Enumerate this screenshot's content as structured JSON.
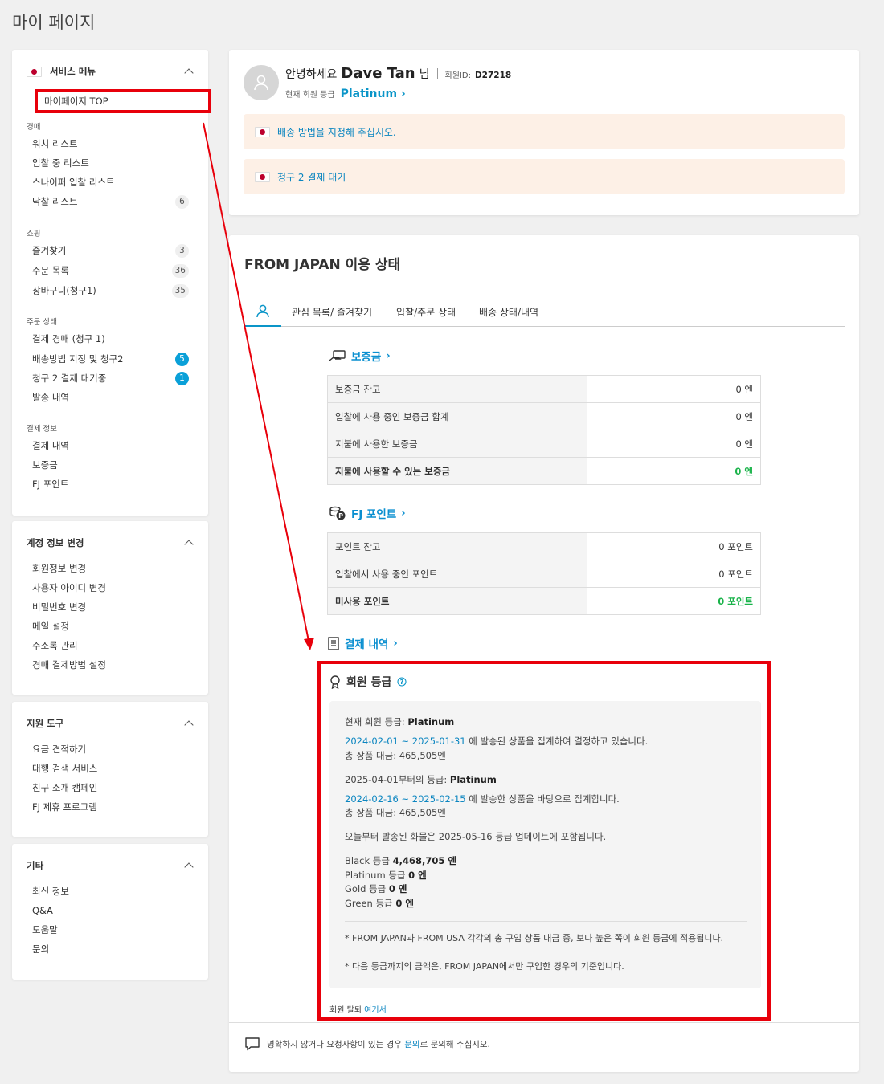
{
  "page_title": "마이 페이지",
  "sidebar": {
    "service_menu": {
      "title": "서비스 메뉴",
      "top_item": "마이페이지 TOP",
      "groups": [
        {
          "label": "경매",
          "items": [
            {
              "label": "워치 리스트",
              "count": ""
            },
            {
              "label": "입찰 중 리스트",
              "count": ""
            },
            {
              "label": "스나이퍼 입찰 리스트",
              "count": ""
            },
            {
              "label": "낙찰 리스트",
              "count": "6"
            }
          ]
        },
        {
          "label": "쇼핑",
          "items": [
            {
              "label": "즐겨찾기",
              "count": "3"
            },
            {
              "label": "주문 목록",
              "count": "36"
            },
            {
              "label": "장바구니(청구1)",
              "count": "35"
            }
          ]
        },
        {
          "label": "주문 상태",
          "items": [
            {
              "label": "결제 경매 (청구 1)",
              "count": ""
            },
            {
              "label": "배송방법 지정 및 청구2",
              "count": "5"
            },
            {
              "label": "청구 2 결제 대기중",
              "count": "1"
            },
            {
              "label": "발송 내역",
              "count": ""
            }
          ]
        },
        {
          "label": "결제 정보",
          "items": [
            {
              "label": "결제 내역"
            },
            {
              "label": "보증금"
            },
            {
              "label": "FJ 포인트"
            }
          ]
        }
      ]
    },
    "account": {
      "title": "계정 정보 변경",
      "items": [
        "회원정보 변경",
        "사용자 아이디 변경",
        "비밀번호 변경",
        "메일 설정",
        "주소록 관리",
        "경매 결제방법 설정"
      ]
    },
    "support": {
      "title": "지원 도구",
      "items": [
        "요금 견적하기",
        "대행 검색 서비스",
        "친구 소개 캠페인",
        "FJ 제휴 프로그램"
      ]
    },
    "etc": {
      "title": "기타",
      "items": [
        "최신 정보",
        "Q&A",
        "도움말",
        "문의"
      ]
    }
  },
  "profile": {
    "hello": "안녕하세요",
    "name": "Dave Tan",
    "honorific": "님",
    "id_label": "회원ID:",
    "id_value": "D27218",
    "grade_label": "현재 회원 등급",
    "grade_value": "Platinum",
    "notices": [
      "배송 방법을 지정해 주십시오.",
      "청구 2 결제 대기"
    ]
  },
  "status": {
    "title": "FROM JAPAN 이용 상태",
    "tabs": [
      "관심 목록/ 즐겨찾기",
      "입찰/주문 상태",
      "배송 상태/내역"
    ],
    "deposit": {
      "title": "보증금",
      "rows": [
        {
          "label": "보증금 잔고",
          "value": "0 엔"
        },
        {
          "label": "입찰에 사용 중인 보증금 합계",
          "value": "0 엔"
        },
        {
          "label": "지불에 사용한 보증금",
          "value": "0 엔"
        },
        {
          "label": "지불에 사용할 수 있는 보증금",
          "value": "0 엔"
        }
      ]
    },
    "points": {
      "title": "FJ 포인트",
      "rows": [
        {
          "label": "포인트 잔고",
          "value": "0 포인트"
        },
        {
          "label": "입찰에서 사용 중인 포인트",
          "value": "0 포인트"
        },
        {
          "label": "미사용 포인트",
          "value": "0 포인트"
        }
      ]
    },
    "payment_history": {
      "title": "결제 내역"
    },
    "membership": {
      "title": "회원 등급",
      "current_label": "현재 회원 등급:",
      "current_value": "Platinum",
      "period1": "2024-02-01 ~ 2025-01-31",
      "period1_text": "에 발송된 상품을 집계하여 결정하고 있습니다.",
      "total1": "총 상품 대금: 465,505엔",
      "next_label": "2025-04-01부터의 등급:",
      "next_value": "Platinum",
      "period2": "2024-02-16 ~ 2025-02-15",
      "period2_text": "에 발송한 상품을 바탕으로 집계합니다.",
      "total2": "총 상품 대금: 465,505엔",
      "update_note": "오늘부터 발송된 화물은 2025-05-16 등급 업데이트에 포함됩니다.",
      "thresholds": [
        {
          "label": "Black 등급",
          "value": "4,468,705 엔"
        },
        {
          "label": "Platinum 등급",
          "value": "0 엔"
        },
        {
          "label": "Gold 등급",
          "value": "0 엔"
        },
        {
          "label": "Green 등급",
          "value": "0 엔"
        }
      ],
      "note1": "* FROM JAPAN과 FROM USA 각각의 총 구입 상품 대금 중, 보다 높은 쪽이 회원 등급에 적용됩니다.",
      "note2": "* 다음 등급까지의 금액은, FROM JAPAN에서만 구입한 경우의 기준입니다.",
      "withdraw_label": "회원 탈퇴",
      "withdraw_link": "여기서"
    },
    "footer": {
      "text_before": "명확하지 않거나 요청사항이 있는 경우",
      "link": "문의",
      "text_after": "로 문의해 주십시오."
    }
  },
  "colors": {
    "accent": "#0a95c8",
    "highlight": "#e8000b",
    "positive": "#1ab34a",
    "notice_bg": "#fdf0e6"
  }
}
